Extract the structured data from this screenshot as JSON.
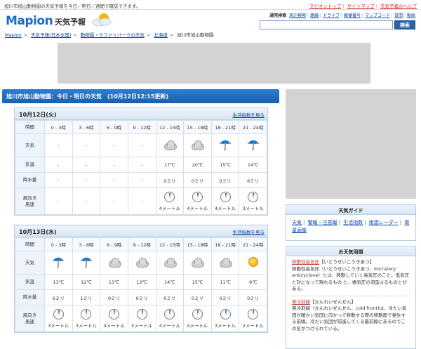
{
  "topbar": {
    "description": "旭川市旭山動物園の天気予報を今日／明日／週間で確認できます。",
    "links": [
      "マピオントップ",
      "サイトマップ",
      "天気予報のヘルプ"
    ]
  },
  "logo": {
    "brand": "Mapion",
    "subtitle": "天気予報"
  },
  "search": {
    "nav_label": "通常検索",
    "nav_items": [
      "周辺検索",
      "路線",
      "ドライブ",
      "郵便番号",
      "マップコード",
      "質問",
      "動画"
    ],
    "query": "",
    "button": "検索"
  },
  "breadcrumb": [
    "Mapion",
    "天気予報(日本全国)",
    "動物園・サファリパークの天気",
    "北海道",
    "旭川市旭山動物園"
  ],
  "page_title": "旭川市旭山動物園：今日・明日の天気　(10月12日12:15更新)",
  "row_labels": {
    "time": "時間",
    "weather": "天気",
    "temp": "気温",
    "precip": "降水量",
    "wind1": "風向き",
    "wind2": "風速"
  },
  "index_link": "生活指数を見る",
  "times": [
    "0 - 3時",
    "3 - 6時",
    "6 - 9時",
    "9 - 12時",
    "12 - 15時",
    "15 - 18時",
    "18 - 21時",
    "21 - 24時"
  ],
  "days": [
    {
      "date": "10月12日(火)",
      "weather": [
        "-",
        "-",
        "-",
        "-",
        "cloud-icon",
        "cloud-icon",
        "umbrella-icon",
        "umbrella-icon"
      ],
      "temp": [
        "-",
        "-",
        "-",
        "-",
        "17℃",
        "20℃",
        "15℃",
        "14℃"
      ],
      "precip": [
        "-",
        "-",
        "-",
        "-",
        "0ミリ",
        "0ミリ",
        "0ミリ",
        "6ミリ"
      ],
      "wind": [
        "-",
        "-",
        "-",
        "-",
        "4メートル",
        "4メートル",
        "4メートル",
        "3メートル"
      ]
    },
    {
      "date": "10月13日(水)",
      "weather": [
        "umbrella-icon",
        "umbrella-icon",
        "cloud-icon",
        "cloud-icon",
        "cloud-icon",
        "cloud-icon",
        "cloud-icon",
        "sun-icon"
      ],
      "temp": [
        "13℃",
        "12℃",
        "13℃",
        "12℃",
        "14℃",
        "15℃",
        "11℃",
        "9℃"
      ],
      "precip": [
        "6ミリ",
        "1ミリ",
        "0ミリ",
        "0ミリ",
        "0ミリ",
        "0ミリ",
        "0ミリ",
        "0ミリ"
      ],
      "wind": [
        "3メートル",
        "3メートル",
        "4メートル",
        "5メートル",
        "4メートル",
        "4メートル",
        "3メートル",
        "2メートル"
      ]
    }
  ],
  "guide": {
    "title": "天気ガイド",
    "links": [
      "天気",
      "警報・注意報",
      "生活指数",
      "雨雲レーダー",
      "衛星画像"
    ]
  },
  "terms": {
    "title": "お天気用語",
    "items": [
      {
        "term": "移動性高気圧",
        "reading": "【いどうせいこうきあつ】",
        "desc": "移動性高気圧（いどうせいこうきあつ、micratory anticyclone）とは、移動していく高気圧のこと。低気圧と対になって現れるもの と、帳気圧の沮型よるものとがある。"
      },
      {
        "term": "寒冷前線",
        "reading": "【かんれいぜんせん】",
        "desc": "寒冷前線（かんれいぜんせん、cold front)は、冷たい気団が暖かい気団に向かって移動する際の移動面で発生する前線。冷たい気団が前進してくる最前線にあるのでこの名がつけられている。"
      }
    ]
  },
  "colors": {
    "brand": "#1b6cc4",
    "title_bar": "#2d7fd1",
    "ad": "#d3d3d3",
    "umbrella": "#1e7fd0"
  }
}
